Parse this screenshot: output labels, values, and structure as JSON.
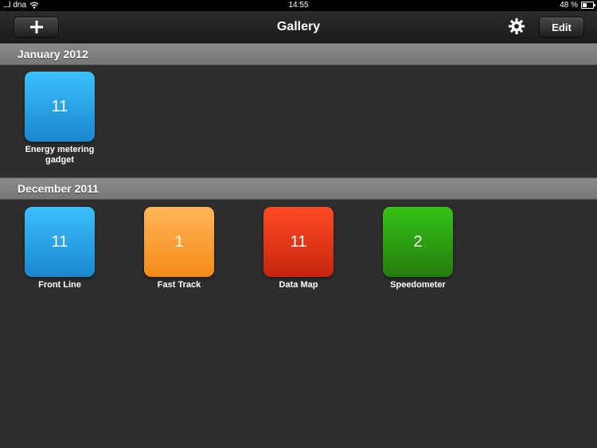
{
  "status": {
    "carrier": "dna",
    "time": "14:55",
    "battery": "48 %"
  },
  "nav": {
    "title": "Gallery",
    "edit_label": "Edit"
  },
  "sections": [
    {
      "title": "January 2012",
      "items": [
        {
          "count": "11",
          "label": "Energy metering gadget",
          "color": "#2aa3ec"
        }
      ]
    },
    {
      "title": "December 2011",
      "items": [
        {
          "count": "11",
          "label": "Front Line",
          "color": "#2aa3ec"
        },
        {
          "count": "1",
          "label": "Fast Track",
          "color": "#f9a13a"
        },
        {
          "count": "11",
          "label": "Data Map",
          "color": "#e03517"
        },
        {
          "count": "2",
          "label": "Speedometer",
          "color": "#2ea311"
        }
      ]
    }
  ]
}
